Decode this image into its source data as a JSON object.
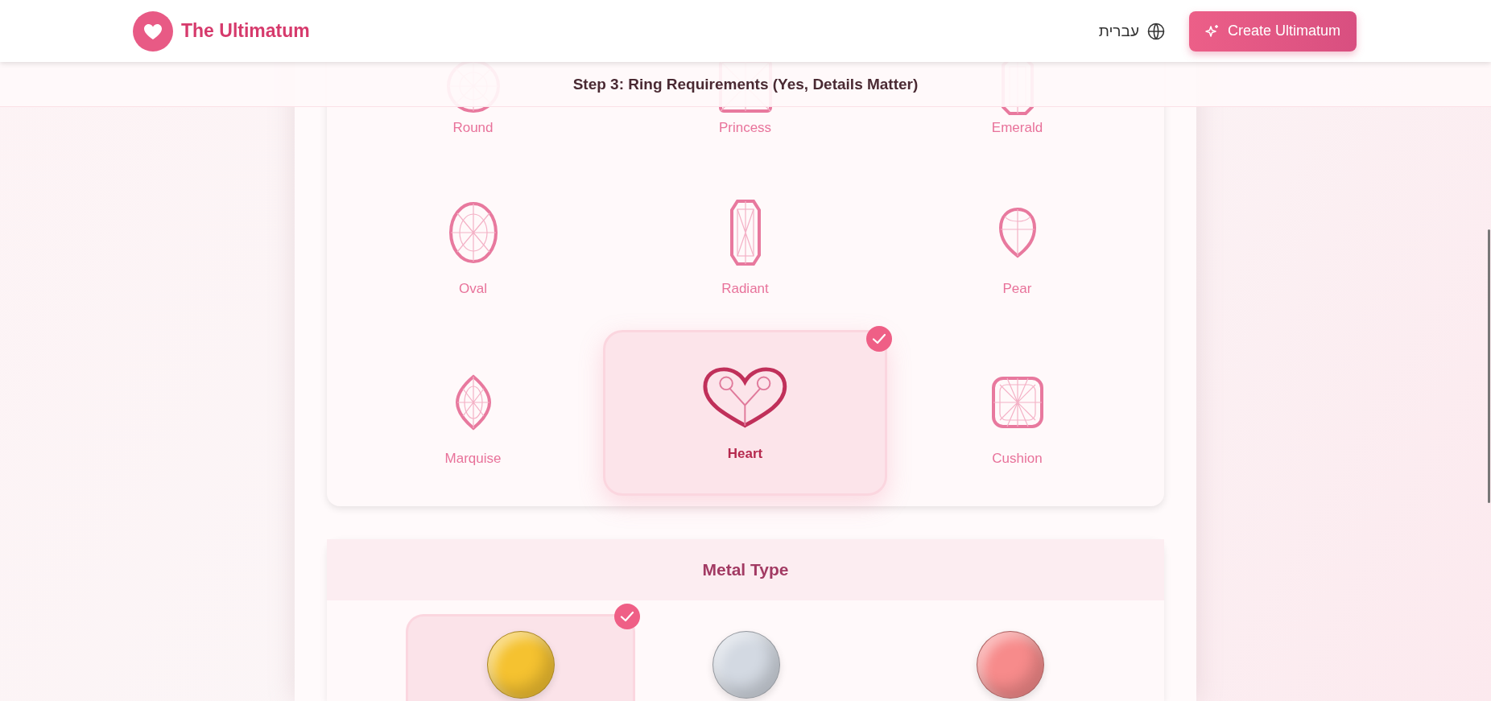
{
  "header": {
    "brand": "The Ultimatum",
    "language": "עברית",
    "create_button": "Create Ultimatum"
  },
  "step_title": "Step 3: Ring Requirements (Yes, Details Matter)",
  "shapes": [
    {
      "kind": "round",
      "label": "Round",
      "selected": false
    },
    {
      "kind": "princess",
      "label": "Princess",
      "selected": false
    },
    {
      "kind": "emerald",
      "label": "Emerald",
      "selected": false
    },
    {
      "kind": "oval",
      "label": "Oval",
      "selected": false
    },
    {
      "kind": "radiant",
      "label": "Radiant",
      "selected": false
    },
    {
      "kind": "pear",
      "label": "Pear",
      "selected": false
    },
    {
      "kind": "marquise",
      "label": "Marquise",
      "selected": false
    },
    {
      "kind": "heart",
      "label": "Heart",
      "selected": true
    },
    {
      "kind": "cushion",
      "label": "Cushion",
      "selected": false
    }
  ],
  "metal": {
    "title": "Metal Type",
    "options": [
      {
        "color": "#f5c230",
        "selected": true
      },
      {
        "color": "#d3d9e2",
        "selected": false
      },
      {
        "color": "#f78b8b",
        "selected": false
      }
    ]
  }
}
